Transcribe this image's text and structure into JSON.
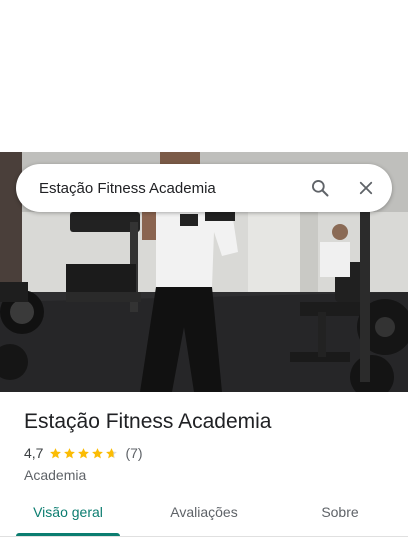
{
  "search": {
    "query": "Estação Fitness Academia",
    "search_icon": "search-icon",
    "close_icon": "close-icon"
  },
  "place": {
    "name": "Estação Fitness Academia",
    "rating_value": "4,7",
    "rating_stars": 4.7,
    "review_count": "(7)",
    "category": "Academia"
  },
  "tabs": [
    {
      "label": "Visão geral",
      "active": true
    },
    {
      "label": "Avaliações",
      "active": false
    },
    {
      "label": "Sobre",
      "active": false
    }
  ],
  "colors": {
    "accent": "#0b7d70",
    "star": "#fbbc04",
    "star_empty": "#dadce0"
  }
}
